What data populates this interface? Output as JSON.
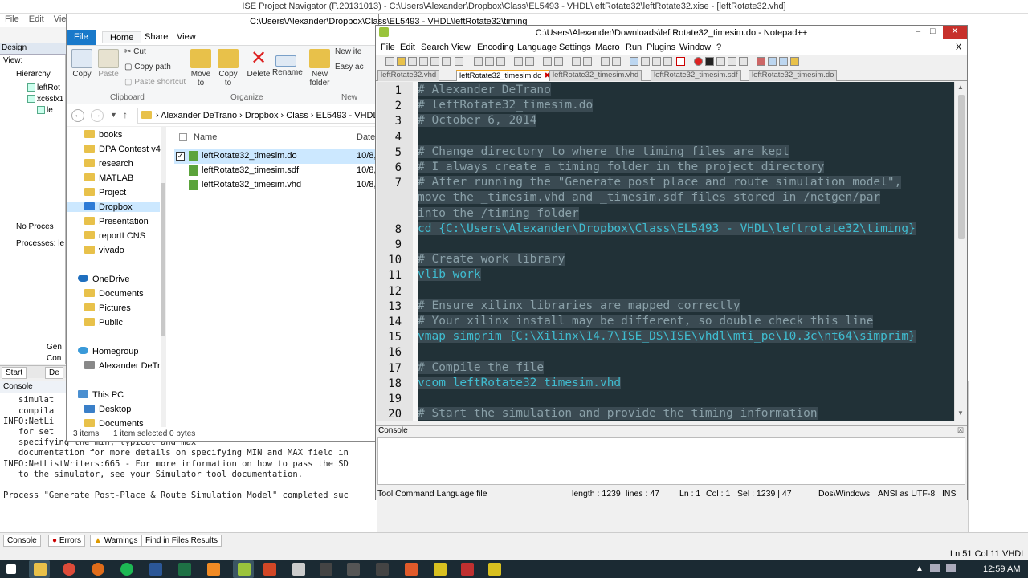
{
  "ise": {
    "title": "ISE Project Navigator (P.20131013) - C:\\Users\\Alexander\\Dropbox\\Class\\EL5493 - VHDL\\leftRotate32\\leftRotate32.xise - [leftRotate32.vhd]",
    "menu": [
      "File",
      "Edit",
      "View"
    ],
    "design_label": "Design",
    "view_label": "View:",
    "hierarchy_label": "Hierarchy",
    "tree": [
      "leftRot",
      "xc6slx1",
      "le"
    ],
    "no_process": "No Proces",
    "processes_label": "Processes: le",
    "gen": "Gen",
    "con": "Con",
    "start_tab": "Start",
    "de_tab": "De",
    "console_title": "Console",
    "console_lines": [
      "   simulat",
      "   compila",
      "INFO:NetLi",
      "   for set",
      "   specifying the min, typical and max",
      "   documentation for more details on specifying MIN and MAX field in",
      "INFO:NetListWriters:665 - For more information on how to pass the SD",
      "   to the simulator, see your Simulator tool documentation.",
      "",
      "Process \"Generate Post-Place & Route Simulation Model\" completed suc"
    ],
    "bottom_tabs": [
      "Console",
      "Errors",
      "Warnings",
      "Find in Files Results"
    ],
    "status_right": [
      "Ln 51 Col 11",
      "VHDL"
    ]
  },
  "explorer": {
    "title": "C:\\Users\\Alexander\\Dropbox\\Class\\EL5493 - VHDL\\leftRotate32\\timing",
    "ribbon_tabs": [
      "File",
      "Home",
      "Share",
      "View"
    ],
    "clipboard": {
      "copy": "Copy",
      "paste": "Paste",
      "cut": "Cut",
      "copy_path": "Copy path",
      "paste_shortcut": "Paste shortcut",
      "group": "Clipboard"
    },
    "organize": {
      "move_to": "Move to",
      "copy_to": "Copy to",
      "delete": "Delete",
      "rename": "Rename",
      "group": "Organize"
    },
    "new": {
      "new_folder": "New folder",
      "new_item": "New ite",
      "easy_access": "Easy ac",
      "group": "New"
    },
    "breadcrumb": [
      "Alexander DeTrano",
      "Dropbox",
      "Class",
      "EL5493 - VHDL"
    ],
    "nav_items": [
      "books",
      "DPA Contest v4",
      "research",
      "MATLAB",
      "Project",
      "Dropbox",
      "Presentation",
      "reportLCNS",
      "vivado",
      "OneDrive",
      "Documents",
      "Pictures",
      "Public",
      "Homegroup",
      "Alexander DeTrar",
      "This PC",
      "Desktop",
      "Documents"
    ],
    "col_name": "Name",
    "col_date": "Date",
    "files": [
      {
        "name": "leftRotate32_timesim.do",
        "date": "10/8,"
      },
      {
        "name": "leftRotate32_timesim.sdf",
        "date": "10/8,"
      },
      {
        "name": "leftRotate32_timesim.vhd",
        "date": "10/8,"
      }
    ],
    "status": {
      "items": "3 items",
      "selected": "1 item selected  0 bytes"
    }
  },
  "npp": {
    "title": "C:\\Users\\Alexander\\Downloads\\leftRotate32_timesim.do - Notepad++",
    "menu": [
      "File",
      "Edit",
      "Search",
      "View",
      "Encoding",
      "Language",
      "Settings",
      "Macro",
      "Run",
      "Plugins",
      "Window",
      "?"
    ],
    "close_x": "X",
    "tabs": [
      "leftRotate32.vhd",
      "leftRotate32_timesim.do",
      "leftRotate32_timesim.vhd",
      "leftRotate32_timesim.sdf",
      "leftRotate32_timesim.do"
    ],
    "line_numbers": [
      "1",
      "2",
      "3",
      "4",
      "5",
      "6",
      "7",
      "",
      "",
      "8",
      "9",
      "10",
      "11",
      "12",
      "13",
      "14",
      "15",
      "16",
      "17",
      "18",
      "19",
      "20"
    ],
    "lines": [
      "# Alexander DeTrano",
      "# leftRotate32_timesim.do",
      "# October 6, 2014",
      "",
      "# Change directory to where the timing files are kept",
      "# I always create a timing folder in the project directory",
      "# After running the \"Generate post place and route simulation model\",",
      "move the _timesim.vhd and _timesim.sdf files stored in /netgen/par",
      "into the /timing folder",
      "cd {C:\\Users\\Alexander\\Dropbox\\Class\\EL5493 - VHDL\\leftrotate32\\timing}",
      "",
      "# Create work library",
      "vlib work",
      "",
      "# Ensure xilinx libraries are mapped correctly",
      "# Your xilinx install may be different, so double check this line",
      "vmap simprim {C:\\Xilinx\\14.7\\ISE_DS\\ISE\\vhdl\\mti_pe\\10.3c\\nt64\\simprim}",
      "",
      "# Compile the file",
      "vcom leftRotate32_timesim.vhd",
      "",
      "# Start the simulation and provide the timing information"
    ],
    "console_label": "Console",
    "status": {
      "lang": "Tool Command Language file",
      "length": "length : 1239",
      "lines": "lines : 47",
      "ln": "Ln : 1",
      "col": "Col : 1",
      "sel": "Sel : 1239 | 47",
      "eol": "Dos\\Windows",
      "enc": "ANSI as UTF-8",
      "ins": "INS"
    }
  },
  "taskbar": {
    "time": "12:59 AM"
  }
}
